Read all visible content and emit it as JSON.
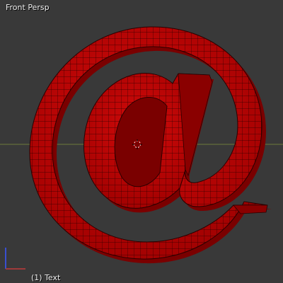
{
  "viewport": {
    "view_name": "Front Persp",
    "active_object": "(1) Text"
  },
  "colors": {
    "background": "#393939",
    "mesh_fill": "#c10000",
    "mesh_shadow": "#6e0000",
    "wire": "#1e0000",
    "x_axis": "#8b3a3a",
    "y_axis": "#6d8b2f",
    "z_axis": "#3a4fd0"
  },
  "icons": [
    "3d-cursor-icon",
    "axis-gizmo-icon"
  ]
}
